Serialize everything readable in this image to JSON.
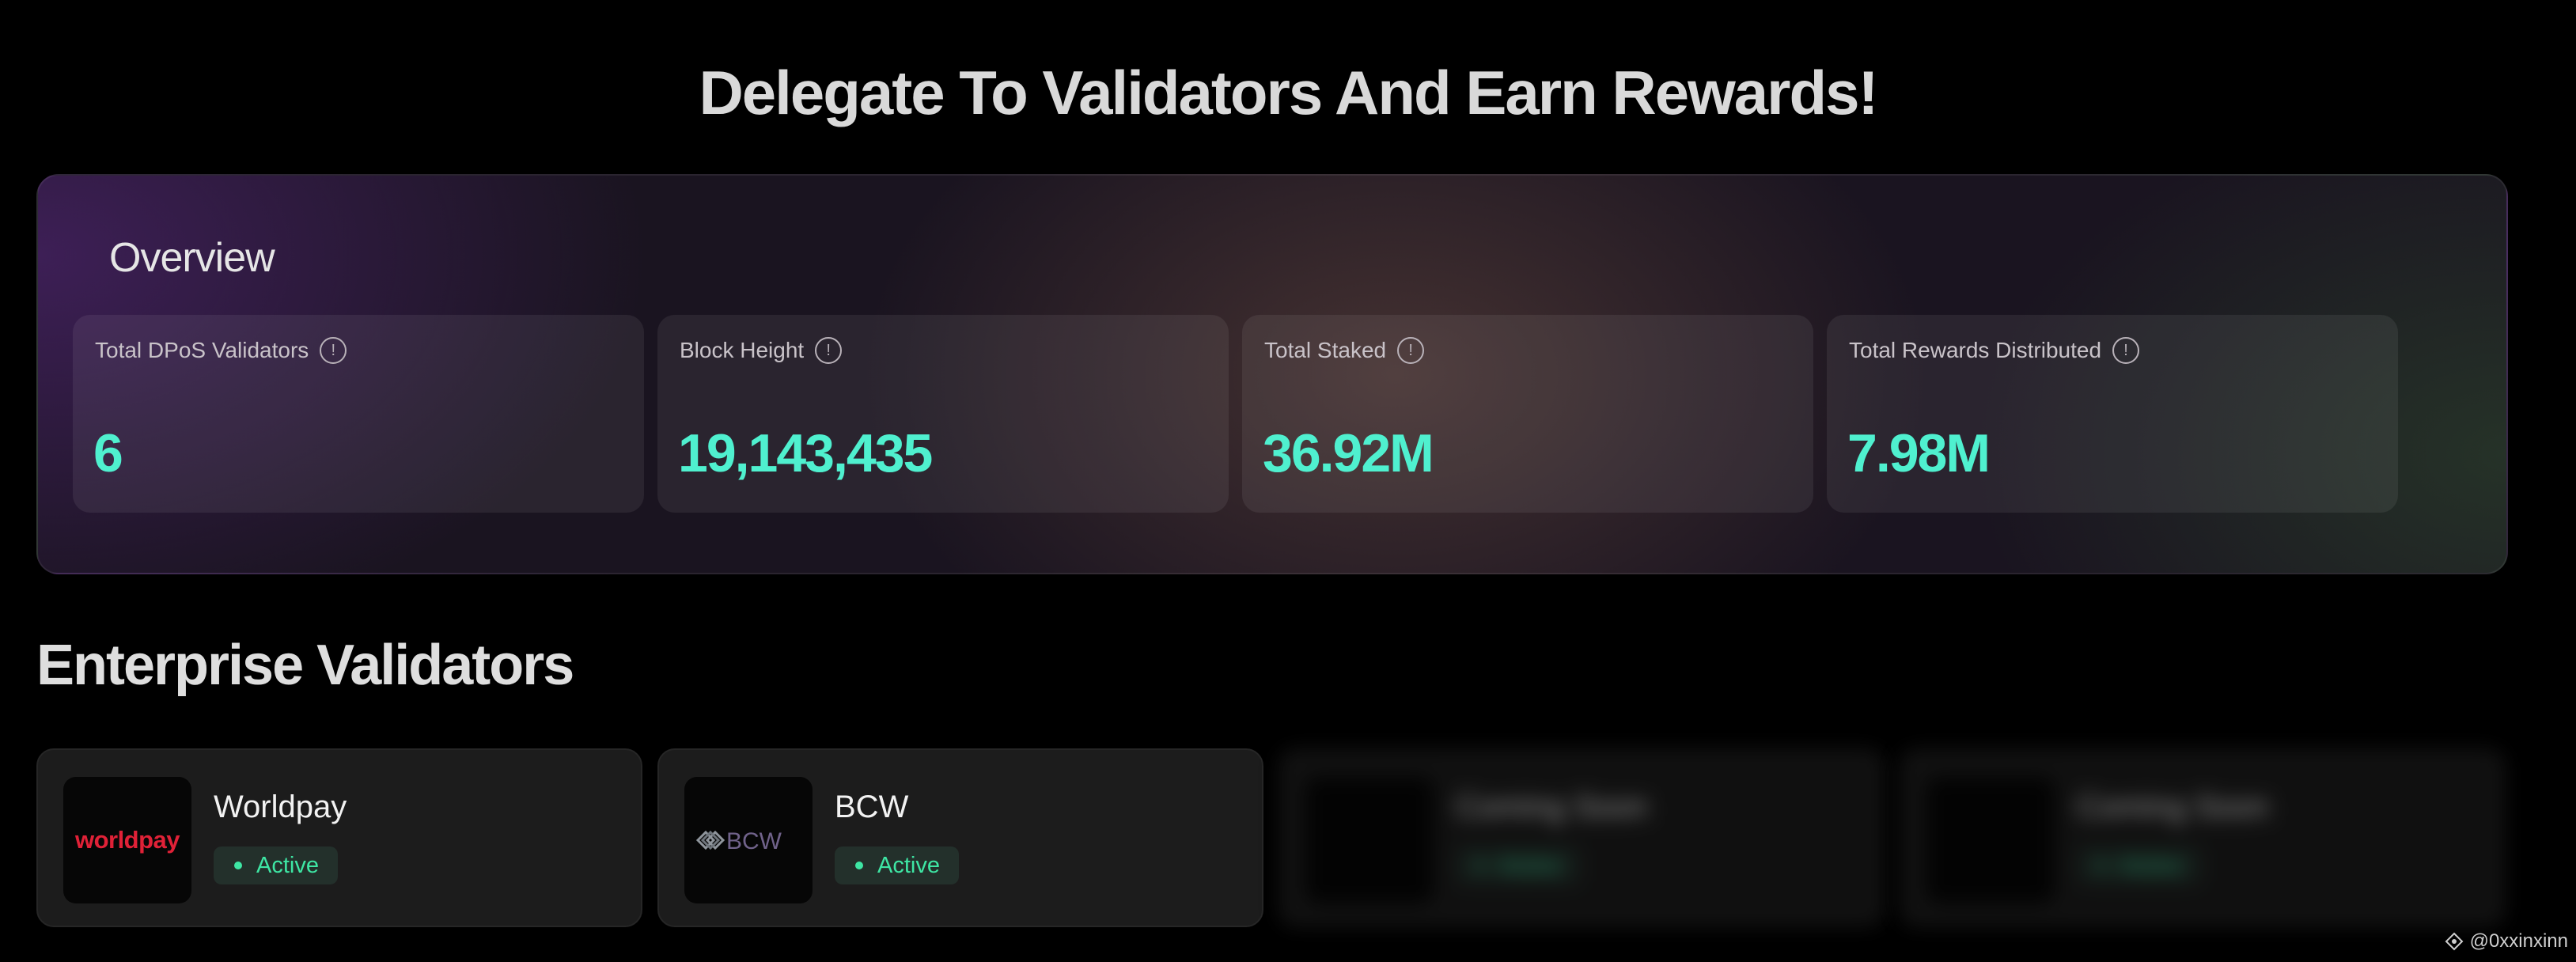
{
  "page_title": "Delegate To Validators And Earn Rewards!",
  "overview": {
    "title": "Overview",
    "stats": [
      {
        "label": "Total DPoS Validators",
        "value": "6"
      },
      {
        "label": "Block Height",
        "value": "19,143,435"
      },
      {
        "label": "Total Staked",
        "value": "36.92M"
      },
      {
        "label": "Total Rewards Distributed",
        "value": "7.98M"
      }
    ]
  },
  "enterprise": {
    "title": "Enterprise Validators",
    "validators": [
      {
        "name": "Worldpay",
        "logo_text": "worldpay",
        "status": "Active"
      },
      {
        "name": "BCW",
        "logo_text": "BCW",
        "status": "Active"
      },
      {
        "name": "Coming Soon",
        "status": "Active"
      },
      {
        "name": "Coming Soon",
        "status": "Active"
      }
    ]
  },
  "watermark": "@0xxinxinn",
  "colors": {
    "accent": "#4ff0cf",
    "status_active": "#3ee6a4",
    "worldpay_brand": "#e02137"
  },
  "icons": [
    "info-icon",
    "status-dot-icon",
    "bcw-logo-icon",
    "watermark-icon"
  ]
}
